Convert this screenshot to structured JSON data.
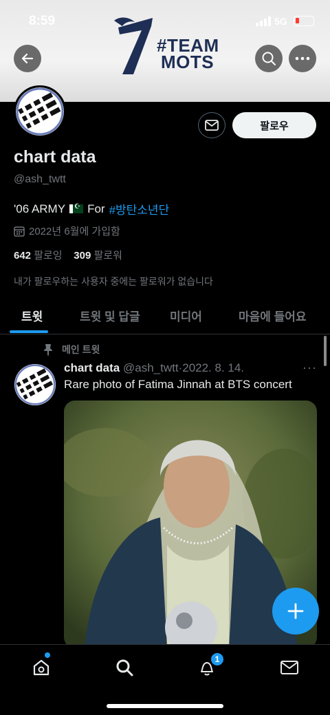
{
  "status_bar": {
    "time": "8:59",
    "network": "5G"
  },
  "banner": {
    "logo_number": "7",
    "logo_line1": "#TEAM",
    "logo_line2": "MOTS"
  },
  "profile": {
    "name": "chart data",
    "handle": "@ash_twtt",
    "bio_prefix": "'06 ARMY",
    "bio_mid": "For",
    "bio_hashtag": "#방탄소년단",
    "joined": "2022년 6월에 가입함",
    "following_count": "642",
    "following_label": "팔로잉",
    "followers_count": "309",
    "followers_label": "팔로워",
    "mutual_note": "내가 팔로우하는 사용자 중에는 팔로워가 없습니다",
    "follow_button": "팔로우"
  },
  "tabs": [
    {
      "label": "트윗",
      "active": true
    },
    {
      "label": "트윗 및 답글",
      "active": false
    },
    {
      "label": "미디어",
      "active": false
    },
    {
      "label": "마음에 들어요",
      "active": false
    }
  ],
  "tweet": {
    "pinned_label": "메인 트윗",
    "author": "chart data",
    "handle": "@ash_twtt",
    "separator": "·",
    "date": "2022. 8. 14.",
    "text": "Rare photo of Fatima Jinnah at BTS concert",
    "more": "···"
  },
  "nav": {
    "notifications_badge": "1"
  },
  "colors": {
    "accent": "#1d9bf0",
    "background": "#000000",
    "muted": "#71767b"
  }
}
